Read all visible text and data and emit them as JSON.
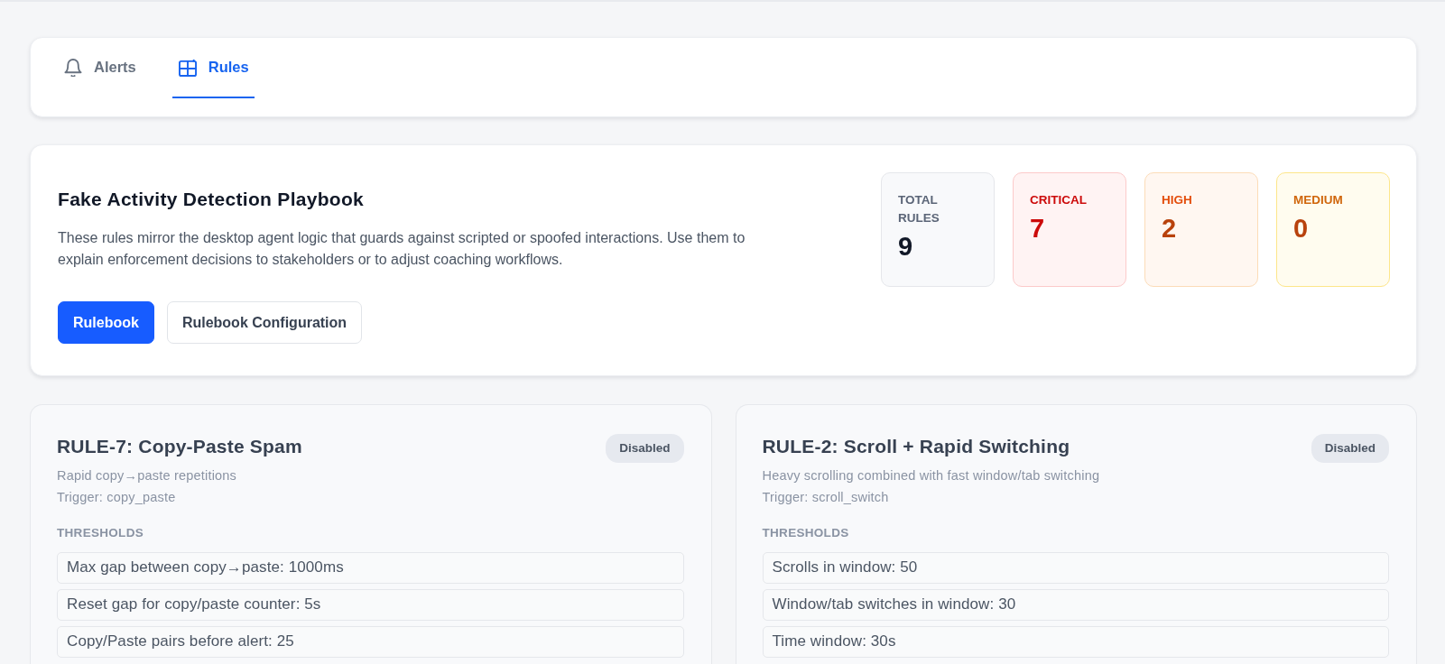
{
  "tabs": [
    {
      "label": "Alerts",
      "selected": false
    },
    {
      "label": "Rules",
      "selected": true
    }
  ],
  "playbook": {
    "title": "Fake Activity Detection Playbook",
    "description": "These rules mirror the desktop agent logic that guards against scripted or spoofed interactions. Use them to explain enforcement decisions to stakeholders or to adjust coaching workflows.",
    "buttons": [
      {
        "label": "Rulebook",
        "selected": true
      },
      {
        "label": "Rulebook Configuration",
        "selected": false
      }
    ]
  },
  "stats": [
    {
      "kind": "total",
      "label": "TOTAL RULES",
      "value": "9"
    },
    {
      "kind": "critical",
      "label": "CRITICAL",
      "value": "7"
    },
    {
      "kind": "high",
      "label": "HIGH",
      "value": "2"
    },
    {
      "kind": "medium",
      "label": "MEDIUM",
      "value": "0"
    }
  ],
  "rules": [
    {
      "title": "RULE-7: Copy-Paste Spam",
      "status": "Disabled",
      "description": "Rapid copy→paste repetitions",
      "trigger": "Trigger: copy_paste",
      "thresholds_heading": "THRESHOLDS",
      "thresholds": [
        "Max gap between copy→paste: 1000ms",
        "Reset gap for copy/paste counter: 5s",
        "Copy/Paste pairs before alert: 25"
      ]
    },
    {
      "title": "RULE-2: Scroll + Rapid Switching",
      "status": "Disabled",
      "description": "Heavy scrolling combined with fast window/tab switching",
      "trigger": "Trigger: scroll_switch",
      "thresholds_heading": "THRESHOLDS",
      "thresholds": [
        "Scrolls in window: 50",
        "Window/tab switches in window: 30",
        "Time window: 30s"
      ]
    }
  ]
}
